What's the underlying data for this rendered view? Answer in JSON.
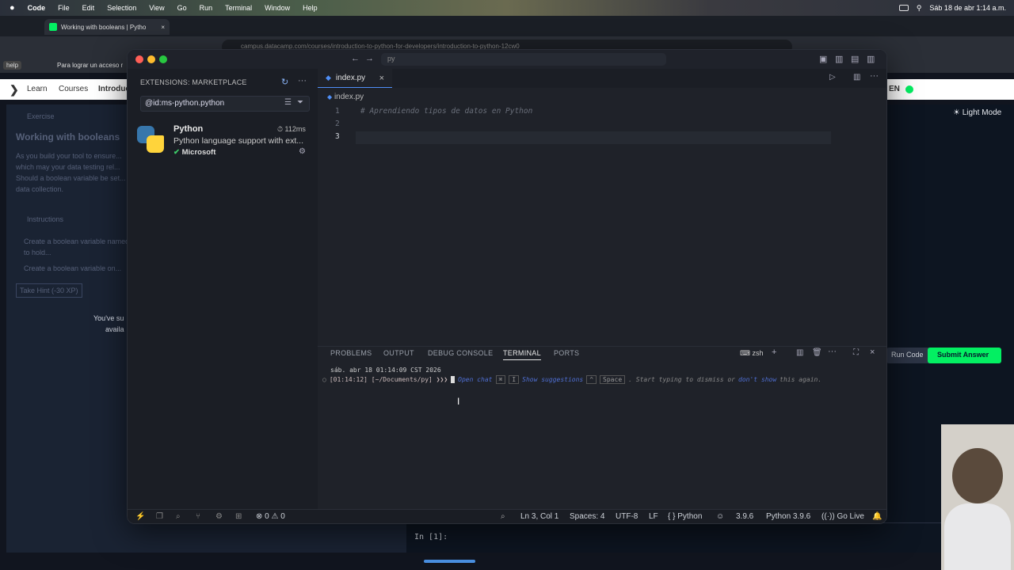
{
  "menubar": {
    "apple": "",
    "app": "Code",
    "items": [
      "File",
      "Edit",
      "Selection",
      "View",
      "Go",
      "Run",
      "Terminal",
      "Window",
      "Help"
    ],
    "clock": "Sáb 18 de abr  1:14 a.m."
  },
  "browser": {
    "tab_title": "Working with booleans | Pytho",
    "url": "campus.datacamp.com/courses/introduction-to-python-for-developers/introduction-to-python-12cw0",
    "bookmark_help": "help",
    "bookmark_text": "Para lograr un acceso r"
  },
  "datacamp": {
    "nav": [
      "Learn",
      "Courses",
      "Introduc"
    ],
    "light_mode": "Light Mode",
    "lang": "EN",
    "exercise_label": "Exercise",
    "exercise_title": "Working with booleans",
    "exercise_body": "As you build your tool to ensure... which may your data testing rel... Should a boolean variable be set... data collection.",
    "instructions_label": "Instructions",
    "inst1": "Create a boolean variable named to hold...",
    "inst2": "Create a boolean variable on...",
    "hint_btn": "Take Hint (-30 XP)",
    "youve": "You've su",
    "availa": "availa",
    "run_code": "Run Code",
    "submit": "Submit Answer",
    "console_prompt": "In [1]:"
  },
  "vscode": {
    "search": "py",
    "sidebar_title": "EXTENSIONS: MARKETPLACE",
    "search_value": "@id:ms-python.python",
    "ext_name": "Python",
    "ext_time": "112ms",
    "ext_desc": "Python language support with ext...",
    "ext_publisher": "Microsoft",
    "tab_label": "index.py",
    "breadcrumb": "index.py",
    "lines": [
      {
        "n": "1",
        "text": "# Aprendiendo tipos de datos en Python"
      },
      {
        "n": "2",
        "text": ""
      },
      {
        "n": "3",
        "text": ""
      }
    ],
    "panel_tabs": [
      "PROBLEMS",
      "OUTPUT",
      "DEBUG CONSOLE",
      "TERMINAL",
      "PORTS"
    ],
    "shell": "zsh",
    "term_line1": "sáb. abr 18 01:14:09 CST 2026",
    "term_prompt": "[01:14:12] [~/Documents/py] ❯❯❯",
    "term_open_chat": "Open chat",
    "term_k1": "⌘",
    "term_k2": "I",
    "term_show_sug": "Show suggestions",
    "term_k3": "^",
    "term_k4": "Space",
    "term_dismiss": ". Start typing to dismiss or",
    "term_dont": "don't show",
    "term_again": "this again.",
    "status": {
      "errors": "0",
      "warnings": "0",
      "position": "Ln 3, Col 1",
      "spaces": "Spaces: 4",
      "encoding": "UTF-8",
      "eol": "LF",
      "language": "Python",
      "py_ver": "3.9.6",
      "interpreter": "Python 3.9.6",
      "go_live": "Go Live"
    }
  }
}
